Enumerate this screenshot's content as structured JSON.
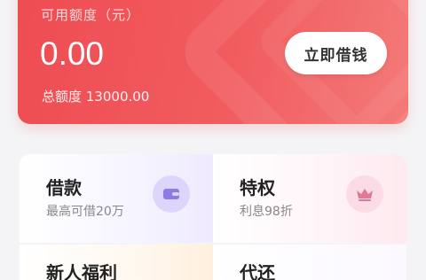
{
  "hero": {
    "available_label": "可用额度（元）",
    "available_amount": "0.00",
    "total_label": "总额度 13000.00",
    "borrow_button": "立即借钱",
    "gradient_start": "#ee4c53",
    "gradient_end": "#f37a78"
  },
  "cards": [
    {
      "title": "借款",
      "subtitle": "最高可借20万",
      "icon": "wallet-icon",
      "icon_color": "#8f7ae6"
    },
    {
      "title": "特权",
      "subtitle": "利息98折",
      "icon": "crown-icon",
      "icon_color": "#e07896"
    },
    {
      "title": "新人福利",
      "icon": "gift-icon"
    },
    {
      "title": "代还",
      "icon": "repay-icon"
    }
  ]
}
